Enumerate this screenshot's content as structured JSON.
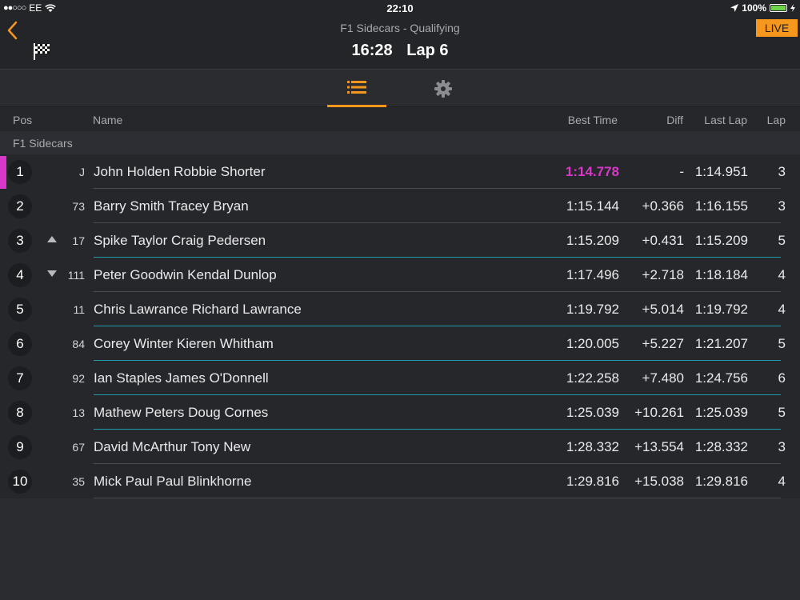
{
  "status_bar": {
    "signal": "●●○○○",
    "carrier": "EE",
    "time": "22:10",
    "battery": "100%",
    "battery_level": 1.0
  },
  "header": {
    "session_title": "F1 Sidecars - Qualifying",
    "clock": "16:28",
    "lap": "Lap 6",
    "live": "LIVE"
  },
  "tabs": [
    {
      "icon": "list-icon",
      "active": true
    },
    {
      "icon": "gear-icon",
      "active": false
    }
  ],
  "columns": {
    "pos": "Pos",
    "name": "Name",
    "best_time": "Best Time",
    "diff": "Diff",
    "last_lap": "Last Lap",
    "lap": "Lap"
  },
  "group": "F1 Sidecars",
  "colors": {
    "accent": "#f5961d",
    "fastest": "#d838c9",
    "improved_separator": "#1e9aa8"
  },
  "rows": [
    {
      "pos": "1",
      "trend": "",
      "num": "J",
      "name": "John Holden Robbie Shorter",
      "best": "1:14.778",
      "diff": "-",
      "last": "1:14.951",
      "lap": "3",
      "fastest": true,
      "sep": "plain"
    },
    {
      "pos": "2",
      "trend": "",
      "num": "73",
      "name": "Barry Smith Tracey Bryan",
      "best": "1:15.144",
      "diff": "+0.366",
      "last": "1:16.155",
      "lap": "3",
      "fastest": false,
      "sep": "plain"
    },
    {
      "pos": "3",
      "trend": "up",
      "num": "17",
      "name": "Spike Taylor Craig Pedersen",
      "best": "1:15.209",
      "diff": "+0.431",
      "last": "1:15.209",
      "lap": "5",
      "fastest": false,
      "sep": "teal"
    },
    {
      "pos": "4",
      "trend": "down",
      "num": "111",
      "name": "Peter Goodwin Kendal Dunlop",
      "best": "1:17.496",
      "diff": "+2.718",
      "last": "1:18.184",
      "lap": "4",
      "fastest": false,
      "sep": "plain"
    },
    {
      "pos": "5",
      "trend": "",
      "num": "11",
      "name": "Chris Lawrance Richard Lawrance",
      "best": "1:19.792",
      "diff": "+5.014",
      "last": "1:19.792",
      "lap": "4",
      "fastest": false,
      "sep": "teal"
    },
    {
      "pos": "6",
      "trend": "",
      "num": "84",
      "name": "Corey Winter Kieren Whitham",
      "best": "1:20.005",
      "diff": "+5.227",
      "last": "1:21.207",
      "lap": "5",
      "fastest": false,
      "sep": "teal"
    },
    {
      "pos": "7",
      "trend": "",
      "num": "92",
      "name": "Ian Staples James O'Donnell",
      "best": "1:22.258",
      "diff": "+7.480",
      "last": "1:24.756",
      "lap": "6",
      "fastest": false,
      "sep": "teal"
    },
    {
      "pos": "8",
      "trend": "",
      "num": "13",
      "name": "Mathew Peters Doug Cornes",
      "best": "1:25.039",
      "diff": "+10.261",
      "last": "1:25.039",
      "lap": "5",
      "fastest": false,
      "sep": "teal"
    },
    {
      "pos": "9",
      "trend": "",
      "num": "67",
      "name": "David McArthur Tony New",
      "best": "1:28.332",
      "diff": "+13.554",
      "last": "1:28.332",
      "lap": "3",
      "fastest": false,
      "sep": "plain"
    },
    {
      "pos": "10",
      "trend": "",
      "num": "35",
      "name": "Mick Paul Paul Blinkhorne",
      "best": "1:29.816",
      "diff": "+15.038",
      "last": "1:29.816",
      "lap": "4",
      "fastest": false,
      "sep": "plain"
    }
  ]
}
